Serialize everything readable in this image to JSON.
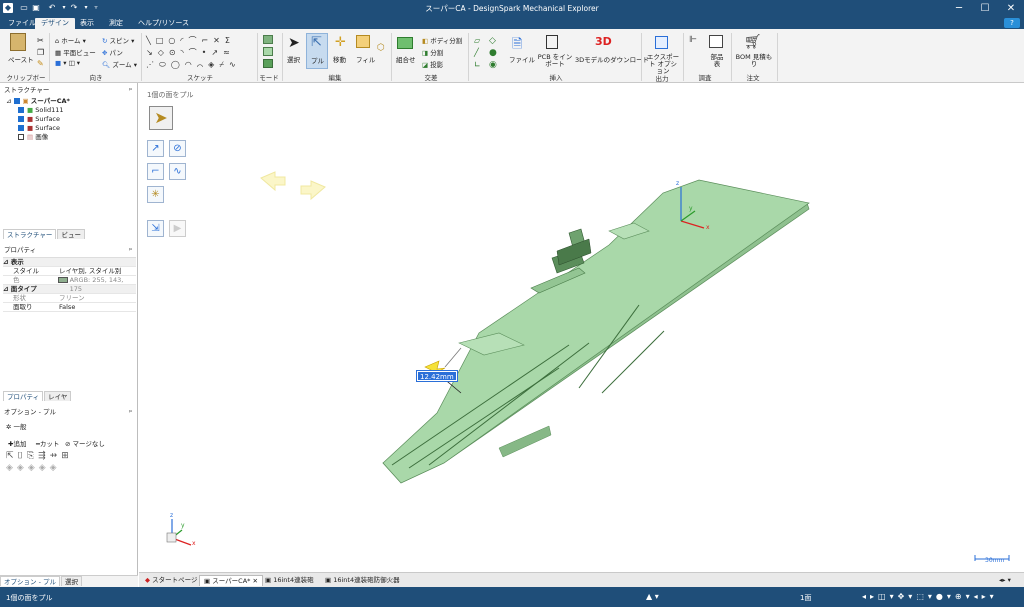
{
  "app": {
    "title": "スーパーCA - DesignSpark Mechanical Explorer"
  },
  "menu": {
    "tabs": [
      "ファイル",
      "デザイン",
      "表示",
      "測定",
      "ヘルプ/リソース"
    ]
  },
  "ribbon": {
    "clipboard": {
      "paste": "ペースト",
      "group": "クリップボード"
    },
    "orient": {
      "home": "ホーム",
      "plan": "平面ビュー",
      "spin": "スピン",
      "pan": "パン",
      "zoom": "ズーム",
      "group": "向き"
    },
    "sketch": {
      "group": "スケッチ"
    },
    "mode": {
      "group": "モード"
    },
    "edit": {
      "select": "選択",
      "pull": "プル",
      "move": "移動",
      "fill": "フィル",
      "group": "編集"
    },
    "intersect": {
      "combine": "組合せ",
      "split_body": "ボディ分割",
      "split": "分割",
      "project": "投影",
      "group": "交差"
    },
    "insert": {
      "file": "ファイル",
      "pcb": "PCB をイン ポート",
      "threed_label": "3D",
      "download": "3Dモデルのダウンロード",
      "group": "挿入"
    },
    "output": {
      "export": "エクスポート オプション",
      "group": "出力"
    },
    "investigate": {
      "parts": "部品 表",
      "group": "調査"
    },
    "order": {
      "bom": "BOM 見積も り",
      "group": "注文"
    }
  },
  "structure": {
    "header": "ストラクチャー",
    "pin": "ᵖ",
    "root": "スーパーCA*",
    "items": [
      {
        "label": "Solid111",
        "checked": true
      },
      {
        "label": "Surface",
        "checked": true
      },
      {
        "label": "Surface",
        "checked": true
      },
      {
        "label": "画像",
        "checked": false
      }
    ],
    "tabs": [
      "ストラクチャー",
      "ビュー"
    ]
  },
  "properties": {
    "header": "プロパティ",
    "pin": "ᵖ",
    "section_display": "表示",
    "style_label": "スタイル",
    "style_value": "レイヤ別, スタイル別",
    "color_label": "色",
    "color_value": "ARGB: 255, 143, 175",
    "section_face": "面タイプ",
    "shape_label": "形状",
    "shape_value": "フリーン",
    "round_label": "面取り",
    "round_value": "False",
    "tabs": [
      "プロパティ",
      "レイヤ"
    ]
  },
  "options": {
    "header": "オプション - プル",
    "pin": "ᵖ",
    "general": "一般",
    "add": "追加",
    "cut": "カット",
    "nomerge": "マージなし"
  },
  "left_bottom_tabs": [
    "オプション - プル",
    "選択"
  ],
  "viewport": {
    "hint": "1個の面をプル",
    "dimension": "12.42mm",
    "scale": "30mm",
    "axis_z": "z",
    "axis_y": "y",
    "axis_x": "x",
    "model_color": "#a9d8a9"
  },
  "doc_tabs": [
    "スタートページ",
    "スーパーCA*",
    "16int4連装砲",
    "16int4連装砲防御火器"
  ],
  "status": {
    "left": "1個の面をプル",
    "count": "1面"
  }
}
